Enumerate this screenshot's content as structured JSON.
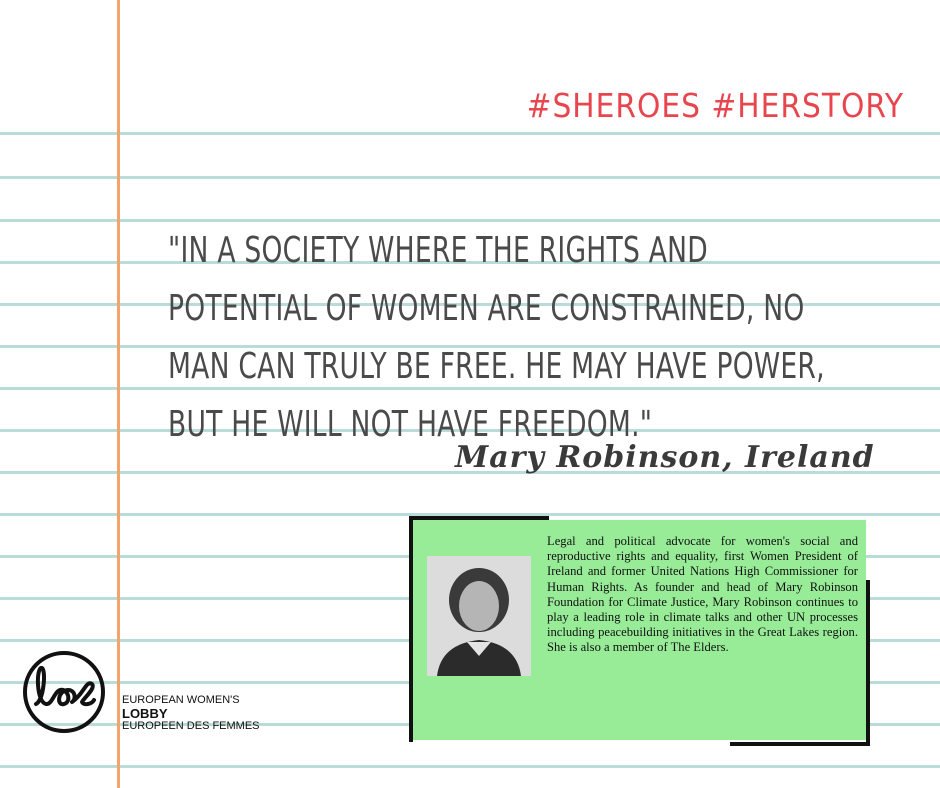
{
  "hashtags": "#SHEROES #HERSTORY",
  "quote": "\"IN A SOCIETY WHERE THE RIGHTS AND POTENTIAL OF WOMEN ARE CONSTRAINED, NO MAN CAN TRULY BE FREE. HE MAY HAVE POWER, BUT HE WILL NOT HAVE FREEDOM.\"",
  "author": "Mary Robinson, Ireland",
  "bio": "Legal and political advocate for women's social and reproductive rights and equality, first Women President of Ireland and former United Nations High Commissioner for Human Rights. As founder and head of Mary Robinson Foundation for Climate Justice, Mary Robinson continues to play a leading role in climate talks and other UN processes including peacebuilding initiatives in the Great Lakes region. She is also a member of The Elders.",
  "organization": {
    "line1": "EUROPEAN WOMEN'S",
    "line2": "LOBBY",
    "line3": "EUROPEEN DES FEMMES"
  },
  "colors": {
    "hashtag": "#e8464f",
    "bio_background": "#98ec98",
    "ruled_line": "#b9dcd8",
    "margin_line": "#f2a46a"
  }
}
